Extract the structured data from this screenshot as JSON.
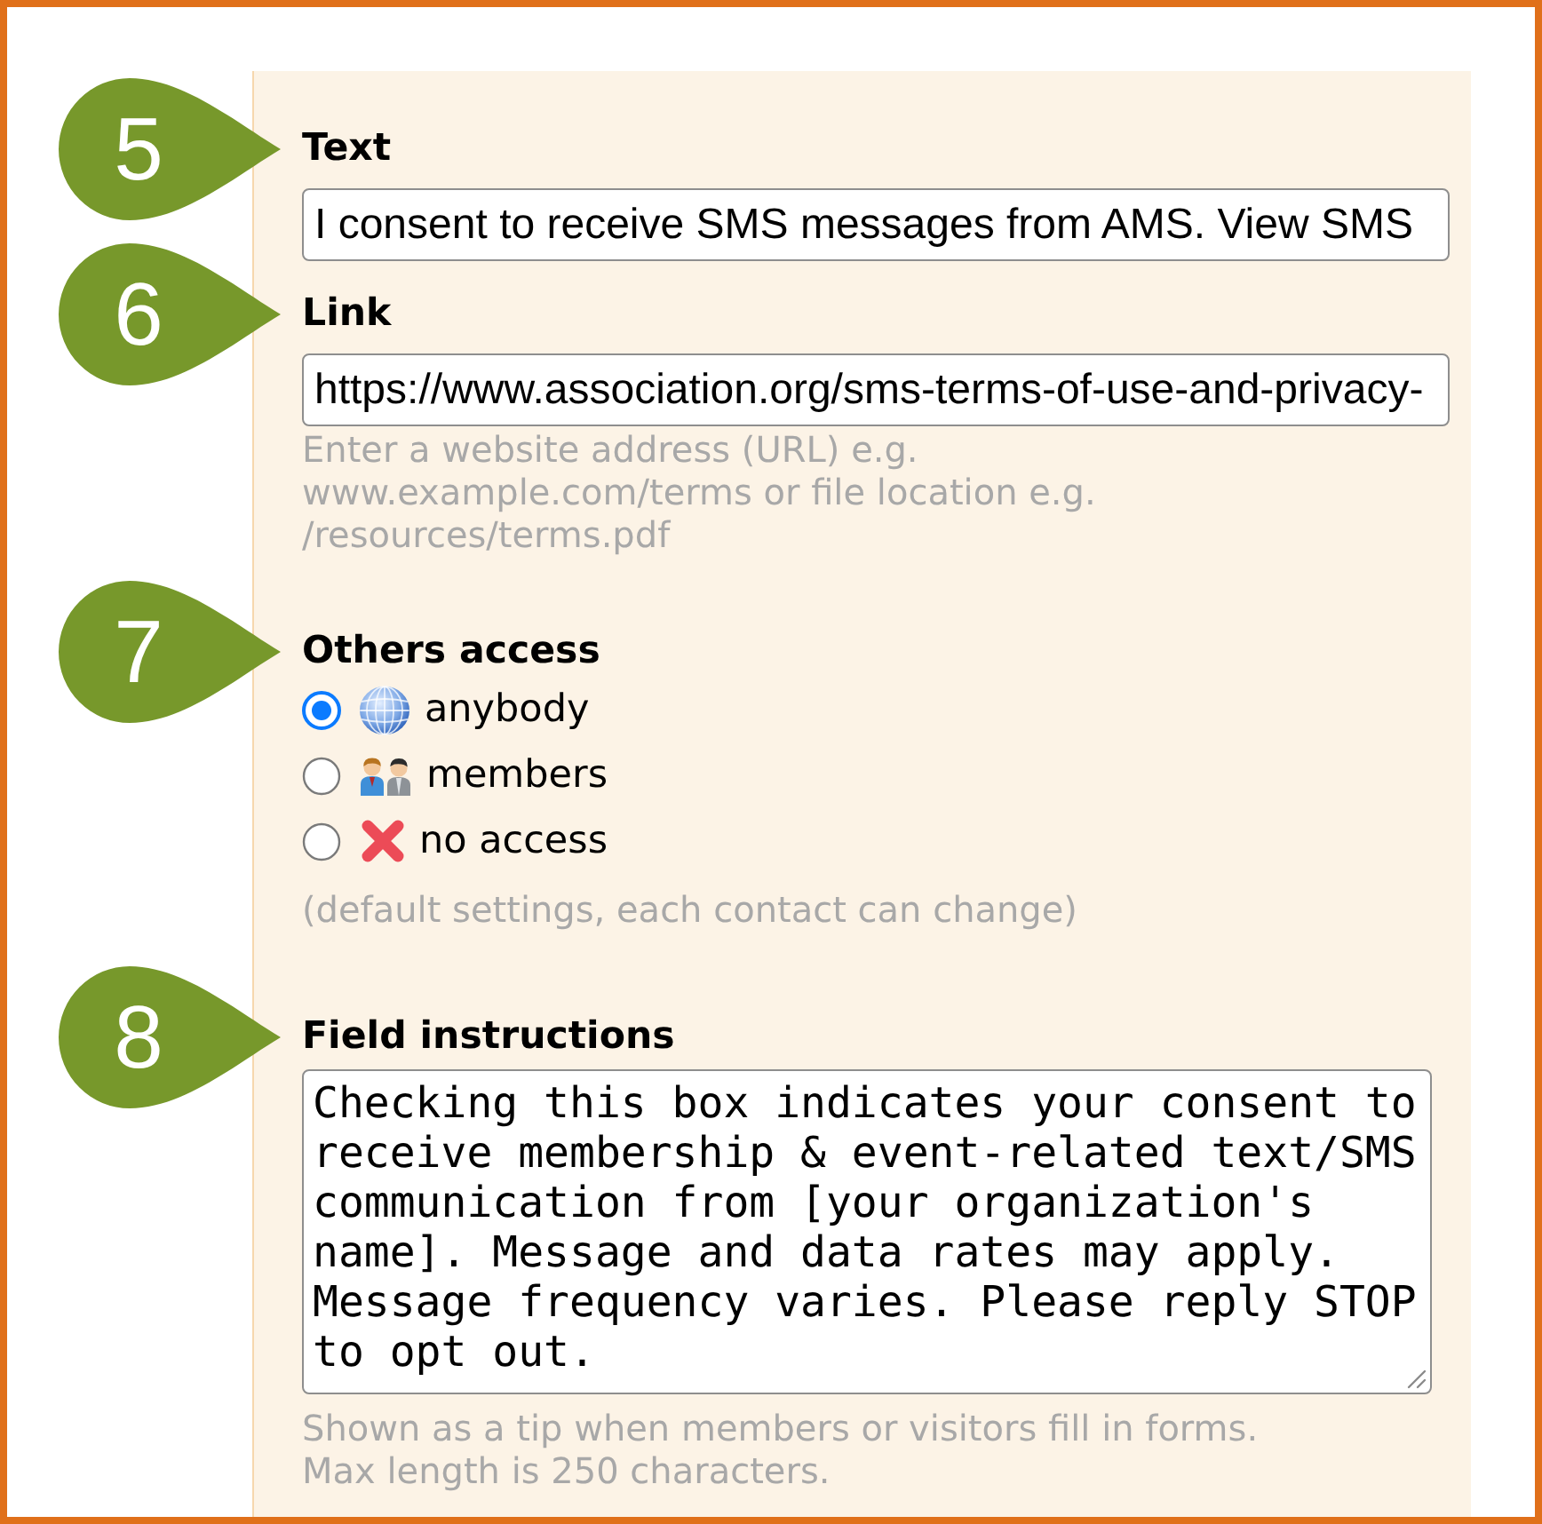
{
  "steps": [
    {
      "marker": "5",
      "label": "Text",
      "kind": "input",
      "value": "I consent to receive SMS messages from AMS. View SMS"
    },
    {
      "marker": "6",
      "label": "Link",
      "kind": "input",
      "value": "https://www.association.org/sms-terms-of-use-and-privacy-",
      "hint": "Enter a website address (URL) e.g. www.example.com/terms or file location e.g. /resources/terms.pdf"
    },
    {
      "marker": "7",
      "label": "Others access",
      "kind": "radio",
      "options": [
        {
          "kind": "public",
          "label": "anybody",
          "selected": true
        },
        {
          "kind": "members",
          "label": "members",
          "selected": false
        },
        {
          "kind": "none",
          "label": "no access",
          "selected": false
        }
      ],
      "hint": "(default settings, each contact can change)"
    },
    {
      "marker": "8",
      "label": "Field instructions",
      "kind": "textarea",
      "value": "Checking this box indicates your consent to receive membership & event-related text/SMS communication from [your organization's name]. Message and data rates may apply. Message frequency varies. Please reply STOP to opt out.",
      "hint": "Shown as a tip when members or visitors fill in forms.\nMax length is 250 characters."
    }
  ]
}
